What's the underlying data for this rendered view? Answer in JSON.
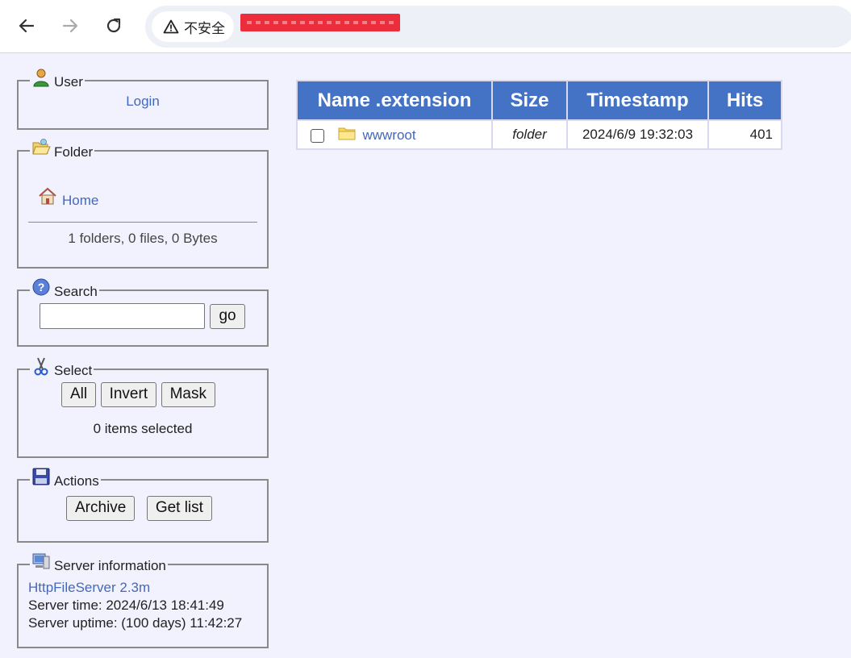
{
  "browser": {
    "security_label": "不安全",
    "icons": {
      "back": "back-arrow-icon",
      "forward": "forward-arrow-icon",
      "reload": "reload-icon",
      "warning": "warning-triangle-icon"
    }
  },
  "sidebar": {
    "user": {
      "title": "User",
      "login": "Login",
      "icon": "user-icon"
    },
    "folder": {
      "title": "Folder",
      "home": "Home",
      "summary": "1 folders, 0 files, 0 Bytes",
      "icon": "folder-open-icon"
    },
    "search": {
      "title": "Search",
      "placeholder": "",
      "value": "",
      "go": "go",
      "icon": "help-icon"
    },
    "select": {
      "title": "Select",
      "all": "All",
      "invert": "Invert",
      "mask": "Mask",
      "status": "0 items selected",
      "icon": "scissors-icon"
    },
    "actions": {
      "title": "Actions",
      "archive": "Archive",
      "get_list": "Get list",
      "icon": "floppy-disk-icon"
    },
    "server": {
      "title": "Server information",
      "link": "HttpFileServer 2.3m",
      "time": "Server time: 2024/6/13 18:41:49",
      "uptime": "Server uptime: (100 days) 11:42:27",
      "icon": "computer-icon"
    }
  },
  "table": {
    "headers": [
      "Name .extension",
      "Size",
      "Timestamp",
      "Hits"
    ],
    "rows": [
      {
        "name": "wwwroot",
        "size": "folder",
        "timestamp": "2024/6/9 19:32:03",
        "hits": "401",
        "checked": false
      }
    ]
  },
  "colors": {
    "background": "#f2f2ff",
    "table_header": "#4473c5",
    "link": "#4468b8",
    "redaction": "#ec2d3c"
  }
}
